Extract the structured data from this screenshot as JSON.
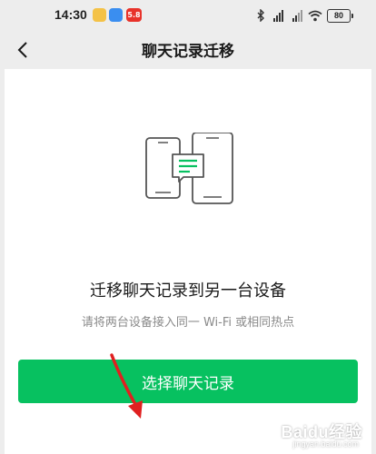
{
  "status_bar": {
    "time": "14:30",
    "notification_badge": "5.8",
    "battery_level": "80",
    "icons": [
      "chat-notification-icon",
      "app-icon",
      "shopping-app-icon",
      "bluetooth-icon",
      "signal-icon",
      "signal-icon",
      "wifi-icon",
      "battery-icon"
    ]
  },
  "nav": {
    "title": "聊天记录迁移",
    "back_icon": "chevron-left-icon"
  },
  "main": {
    "illustration_icon": "two-phones-transfer-icon",
    "heading": "迁移聊天记录到另一台设备",
    "subtext": "请将两台设备接入同一 Wi-Fi 或相同热点",
    "button_label": "选择聊天记录"
  },
  "watermark": {
    "main": "Baidu经验",
    "sub": "jingyan.baidu.com"
  },
  "colors": {
    "accent": "#07c160",
    "background": "#ededed",
    "annotation_arrow": "#e02020"
  }
}
